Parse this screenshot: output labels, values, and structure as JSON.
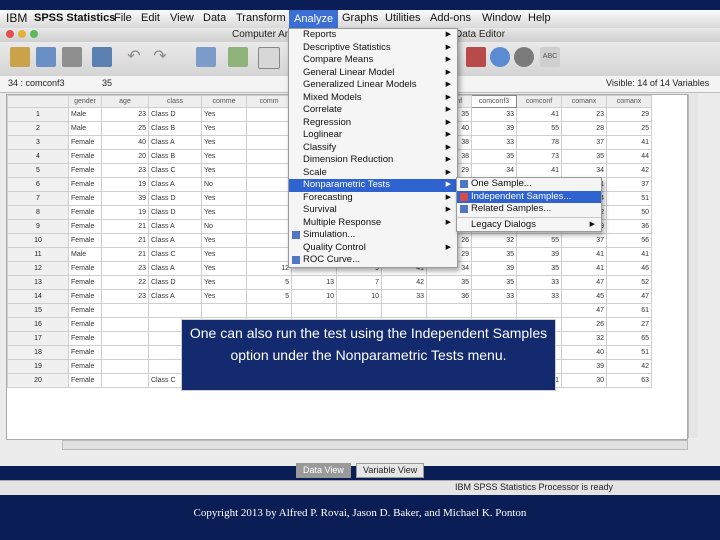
{
  "menubar": {
    "logo": "IBM",
    "items": [
      "SPSS Statistics",
      "File",
      "Edit",
      "View",
      "Data",
      "Transform",
      "Analyze",
      "Graphs",
      "Utilities",
      "Add-ons",
      "Window",
      "Help"
    ],
    "active": "Analyze",
    "accent": "#3b6fd6"
  },
  "window": {
    "title_left": "Computer Anx",
    "title_right": "Data Editor"
  },
  "cellbar": {
    "cell_ref": "34 : comconf3",
    "cell_value": "35",
    "visible": "Visible: 14 of 14 Variables"
  },
  "grid": {
    "columns": [
      "gender",
      "age",
      "class",
      "comme",
      "comm",
      "",
      "",
      "",
      "comconf",
      "comconf3",
      "comconf",
      "comanx",
      "comanx"
    ],
    "rows": [
      {
        "n": "1",
        "c": [
          "Male",
          "23",
          "Class D",
          "Yes",
          "",
          "",
          "",
          "",
          "35",
          "33",
          "41",
          "23",
          "29"
        ]
      },
      {
        "n": "2",
        "c": [
          "Male",
          "25",
          "Class B",
          "Yes",
          "",
          "",
          "",
          "38",
          "40",
          "39",
          "55",
          "28",
          "25"
        ]
      },
      {
        "n": "3",
        "c": [
          "Female",
          "40",
          "Class A",
          "Yes",
          "",
          "",
          "",
          "33",
          "38",
          "33",
          "78",
          "37",
          "41"
        ]
      },
      {
        "n": "4",
        "c": [
          "Female",
          "20",
          "Class B",
          "Yes",
          "",
          "",
          "",
          "",
          "38",
          "35",
          "73",
          "35",
          "44"
        ]
      },
      {
        "n": "5",
        "c": [
          "Female",
          "23",
          "Class C",
          "Yes",
          "",
          "",
          "",
          "",
          "29",
          "34",
          "41",
          "34",
          "42"
        ]
      },
      {
        "n": "6",
        "c": [
          "Female",
          "19",
          "Class A",
          "No",
          "",
          "",
          "",
          "",
          "",
          "",
          "",
          "41",
          "37"
        ]
      },
      {
        "n": "7",
        "c": [
          "Female",
          "39",
          "Class D",
          "Yes",
          "",
          "",
          "",
          "",
          "",
          "",
          "",
          "34",
          "51"
        ]
      },
      {
        "n": "8",
        "c": [
          "Female",
          "19",
          "Class D",
          "Yes",
          "",
          "",
          "",
          "",
          "",
          "",
          "",
          "42",
          "50"
        ]
      },
      {
        "n": "9",
        "c": [
          "Female",
          "21",
          "Class A",
          "No",
          "",
          "",
          "",
          "",
          "",
          "",
          "",
          "39",
          "36"
        ]
      },
      {
        "n": "10",
        "c": [
          "Female",
          "21",
          "Class A",
          "Yes",
          "",
          "",
          "",
          "",
          "26",
          "32",
          "55",
          "37",
          "56"
        ]
      },
      {
        "n": "11",
        "c": [
          "Male",
          "21",
          "Class C",
          "Yes",
          "",
          "",
          "",
          "",
          "29",
          "35",
          "39",
          "41",
          "41"
        ]
      },
      {
        "n": "12",
        "c": [
          "Female",
          "23",
          "Class A",
          "Yes",
          "12",
          "",
          "9",
          "41",
          "34",
          "39",
          "35",
          "41",
          "46"
        ]
      },
      {
        "n": "13",
        "c": [
          "Female",
          "22",
          "Class D",
          "Yes",
          "5",
          "13",
          "7",
          "42",
          "35",
          "35",
          "33",
          "47",
          "52"
        ]
      },
      {
        "n": "14",
        "c": [
          "Female",
          "23",
          "Class A",
          "Yes",
          "5",
          "10",
          "10",
          "33",
          "36",
          "33",
          "33",
          "45",
          "47"
        ]
      },
      {
        "n": "15",
        "c": [
          "Female",
          "",
          "",
          "",
          "",
          "",
          "",
          "",
          "",
          "",
          "",
          "47",
          "61"
        ]
      },
      {
        "n": "16",
        "c": [
          "Female",
          "",
          "",
          "",
          "",
          "",
          "",
          "",
          "",
          "",
          "",
          "26",
          "27"
        ]
      },
      {
        "n": "17",
        "c": [
          "Female",
          "",
          "",
          "",
          "",
          "",
          "",
          "",
          "",
          "",
          "",
          "32",
          "65"
        ]
      },
      {
        "n": "18",
        "c": [
          "Female",
          "",
          "",
          "",
          "",
          "",
          "",
          "",
          "",
          "",
          "",
          "40",
          "51"
        ]
      },
      {
        "n": "19",
        "c": [
          "Female",
          "",
          "",
          "",
          "",
          "",
          "",
          "",
          "",
          "",
          "",
          "39",
          "42"
        ]
      },
      {
        "n": "20",
        "c": [
          "Female",
          "",
          "Class C",
          "No",
          "10",
          "15",
          "",
          "58",
          "33",
          "32",
          "31",
          "30",
          "63"
        ]
      }
    ]
  },
  "analyze_menu": {
    "items": [
      {
        "label": "Reports",
        "sub": true
      },
      {
        "label": "Descriptive Statistics",
        "sub": true
      },
      {
        "label": "Compare Means",
        "sub": true
      },
      {
        "label": "General Linear Model",
        "sub": true
      },
      {
        "label": "Generalized Linear Models",
        "sub": true
      },
      {
        "label": "Mixed Models",
        "sub": true
      },
      {
        "label": "Correlate",
        "sub": true
      },
      {
        "label": "Regression",
        "sub": true
      },
      {
        "label": "Loglinear",
        "sub": true
      },
      {
        "label": "Classify",
        "sub": true
      },
      {
        "label": "Dimension Reduction",
        "sub": true
      },
      {
        "label": "Scale",
        "sub": true
      },
      {
        "label": "Nonparametric Tests",
        "sub": true,
        "selected": true
      },
      {
        "label": "Forecasting",
        "sub": true
      },
      {
        "label": "Survival",
        "sub": true
      },
      {
        "label": "Multiple Response",
        "sub": true
      },
      {
        "label": "Simulation...",
        "sub": false,
        "icon": true
      },
      {
        "label": "Quality Control",
        "sub": true
      },
      {
        "label": "ROC Curve...",
        "sub": false,
        "icon": true
      }
    ]
  },
  "nonparam_menu": {
    "items": [
      {
        "label": "One Sample...",
        "icon": true
      },
      {
        "label": "Independent Samples...",
        "icon": true,
        "selected": true
      },
      {
        "label": "Related Samples...",
        "icon": true
      },
      {
        "label": "Legacy Dialogs",
        "sub": true
      }
    ]
  },
  "tabs": {
    "data_view": "Data View",
    "variable_view": "Variable View"
  },
  "status": "IBM SPSS Statistics Processor is ready",
  "callout": "One can also run the test using the Independent Samples option under the Nonparametric Tests menu.",
  "copyright": "Copyright 2013 by Alfred P. Rovai, Jason D. Baker, and Michael K. Ponton",
  "colors": {
    "slide_bg": "#0b1d55",
    "selection": "#2f63d0",
    "callout_bg": "#142a6e"
  }
}
